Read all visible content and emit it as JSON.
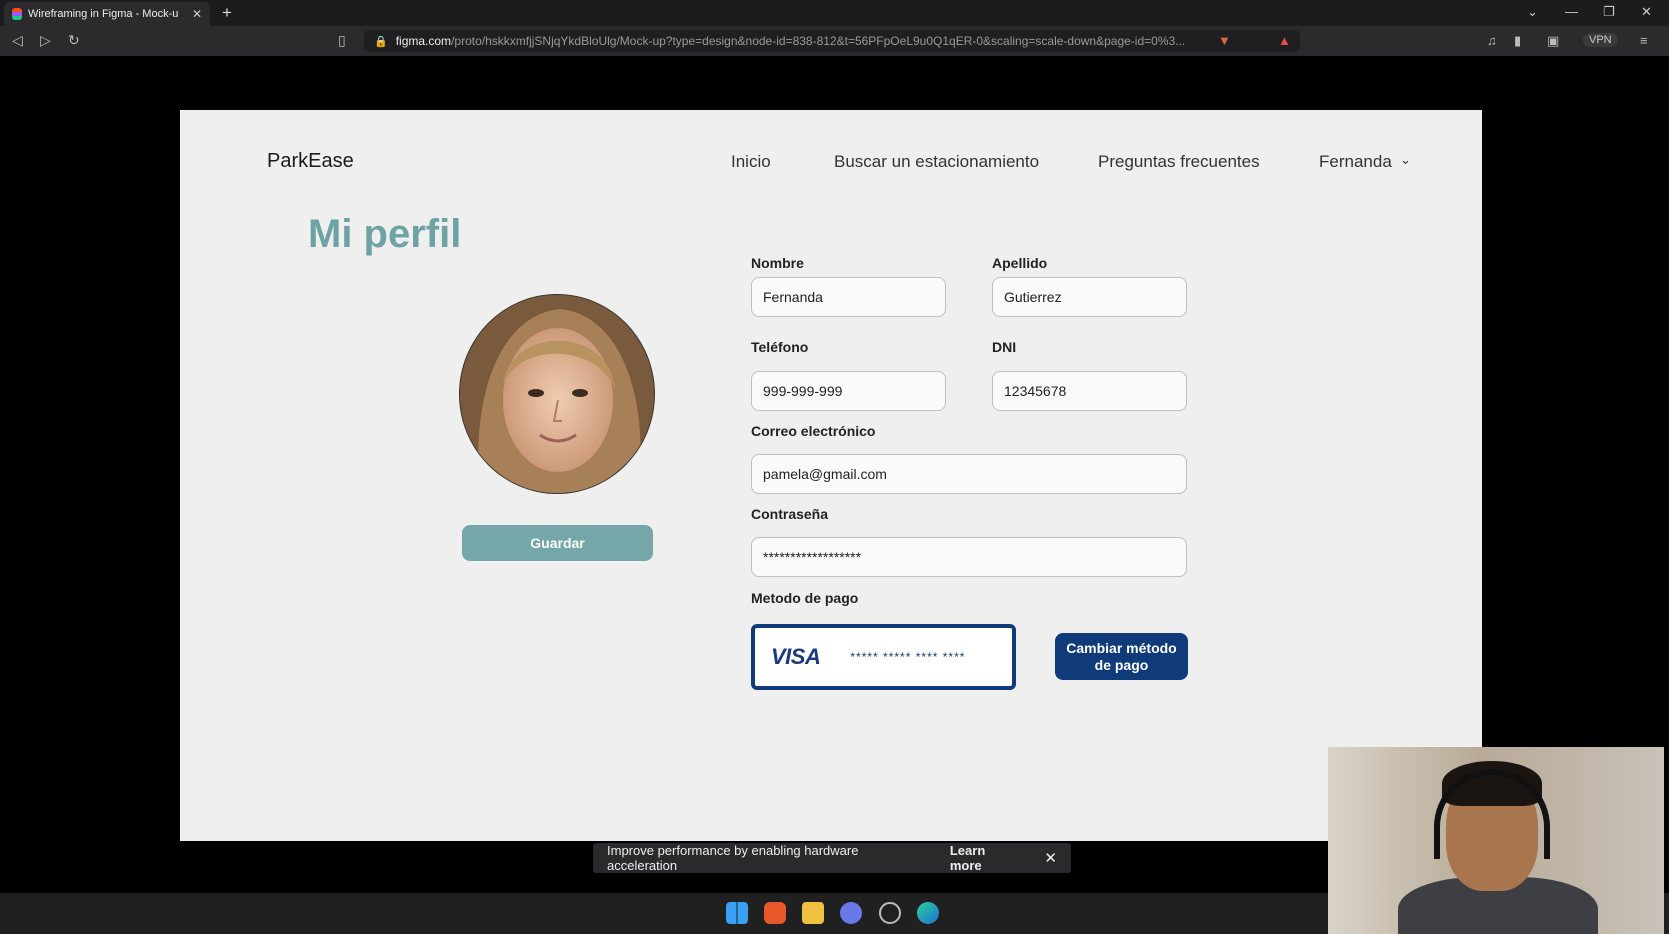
{
  "browser": {
    "tab_title": "Wireframing in Figma - Mock-u",
    "url_host": "figma.com",
    "url_path": "/proto/hskkxmfjjSNjqYkdBloUlg/Mock-up?type=design&node-id=838-812&t=56PFpOeL9u0Q1qER-0&scaling=scale-down&page-id=0%3...",
    "vpn_label": "VPN"
  },
  "site": {
    "logo": "ParkEase",
    "nav": {
      "home": "Inicio",
      "search": "Buscar un estacionamiento",
      "faq": "Preguntas frecuentes",
      "user": "Fernanda"
    }
  },
  "profile": {
    "heading": "Mi perfil",
    "save_label": "Guardar",
    "first_name_label": "Nombre",
    "first_name_value": "Fernanda",
    "last_name_label": "Apellido",
    "last_name_value": "Gutierrez",
    "phone_label": "Teléfono",
    "phone_value": "999-999-999",
    "dni_label": "DNI",
    "dni_value": "12345678",
    "email_label": "Correo electrónico",
    "email_value": "pamela@gmail.com",
    "password_label": "Contraseña",
    "password_value": "******************",
    "payment_label": "Metodo de pago",
    "card_brand": "VISA",
    "card_number": "***** ***** **** ****",
    "change_payment_label": "Cambiar método de pago"
  },
  "notification": {
    "text": "Improve performance by enabling hardware acceleration",
    "learn_more": "Learn more"
  },
  "colors": {
    "accent_teal": "#6ea3a4",
    "navy": "#0f3b7a"
  }
}
